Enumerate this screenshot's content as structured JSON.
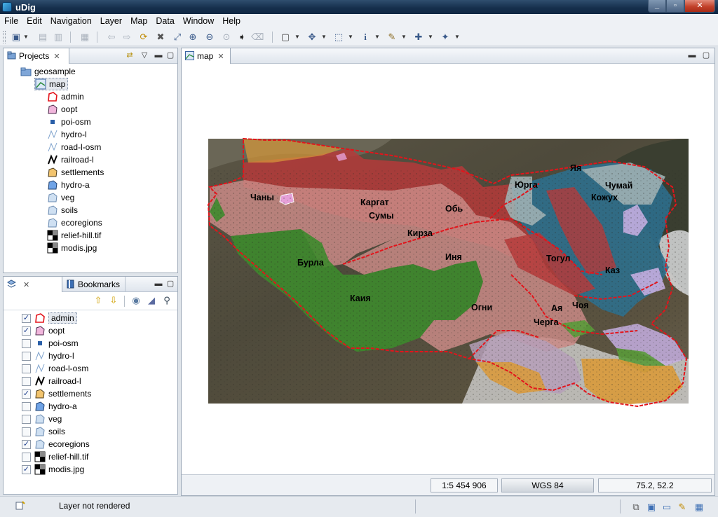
{
  "window": {
    "title": "uDig",
    "controls": {
      "minimize": "_",
      "maximize": "▫",
      "close": "✕"
    }
  },
  "menu": [
    "File",
    "Edit",
    "Navigation",
    "Layer",
    "Map",
    "Data",
    "Window",
    "Help"
  ],
  "projects_view": {
    "tab_label": "Projects",
    "close": "✕",
    "project": "geosample",
    "map": "map",
    "layers": [
      {
        "name": "admin",
        "icon": "polygon-outline-red"
      },
      {
        "name": "oopt",
        "icon": "polygon-pink"
      },
      {
        "name": "poi-osm",
        "icon": "point-blue"
      },
      {
        "name": "hydro-l",
        "icon": "line-blue"
      },
      {
        "name": "road-l-osm",
        "icon": "line-blue"
      },
      {
        "name": "railroad-l",
        "icon": "line-black"
      },
      {
        "name": "settlements",
        "icon": "polygon-orange"
      },
      {
        "name": "hydro-a",
        "icon": "polygon-blue"
      },
      {
        "name": "veg",
        "icon": "polygon-lightblue"
      },
      {
        "name": "soils",
        "icon": "polygon-lightblue"
      },
      {
        "name": "ecoregions",
        "icon": "polygon-lightblue"
      },
      {
        "name": "relief-hill.tif",
        "icon": "raster"
      },
      {
        "name": "modis.jpg",
        "icon": "raster"
      }
    ]
  },
  "layers_view": {
    "tab_layers": "Layers",
    "tab_bookmarks": "Bookmarks",
    "close": "✕",
    "layers": [
      {
        "name": "admin",
        "checked": true,
        "selected": true,
        "icon": "polygon-outline-red"
      },
      {
        "name": "oopt",
        "checked": true,
        "icon": "polygon-pink"
      },
      {
        "name": "poi-osm",
        "checked": false,
        "icon": "point-blue"
      },
      {
        "name": "hydro-l",
        "checked": false,
        "icon": "line-blue"
      },
      {
        "name": "road-l-osm",
        "checked": false,
        "icon": "line-blue"
      },
      {
        "name": "railroad-l",
        "checked": false,
        "icon": "line-black"
      },
      {
        "name": "settlements",
        "checked": true,
        "icon": "polygon-orange"
      },
      {
        "name": "hydro-a",
        "checked": false,
        "icon": "polygon-blue"
      },
      {
        "name": "veg",
        "checked": false,
        "icon": "polygon-lightblue"
      },
      {
        "name": "soils",
        "checked": false,
        "icon": "polygon-lightblue"
      },
      {
        "name": "ecoregions",
        "checked": true,
        "icon": "polygon-lightblue"
      },
      {
        "name": "relief-hill.tif",
        "checked": false,
        "icon": "raster"
      },
      {
        "name": "modis.jpg",
        "checked": true,
        "icon": "raster"
      }
    ]
  },
  "map_editor": {
    "tab_label": "map",
    "close": "✕",
    "scale": "1:5 454 906",
    "crs": "WGS 84",
    "coords": "75.2, 52.2"
  },
  "map_labels": [
    "Чаны",
    "Каргат",
    "Сумы",
    "Обь",
    "Кирза",
    "Юрга",
    "Яя",
    "Чумай",
    "Кожух",
    "Бурла",
    "Иня",
    "Тогул",
    "Каз",
    "Каия",
    "Огни",
    "Ая",
    "Чоя",
    "Черга"
  ],
  "status": {
    "message": "Layer not rendered"
  },
  "colors": {
    "admin_border": "#e3141b",
    "red_region": "#b53a3a",
    "pink_region": "#c98a86",
    "green_region": "#3d8a2c",
    "blue_region": "#2c6f8e",
    "gray_region": "#9fb0b3",
    "orange_region": "#d99a3a",
    "lavender_region": "#c4aee0"
  }
}
